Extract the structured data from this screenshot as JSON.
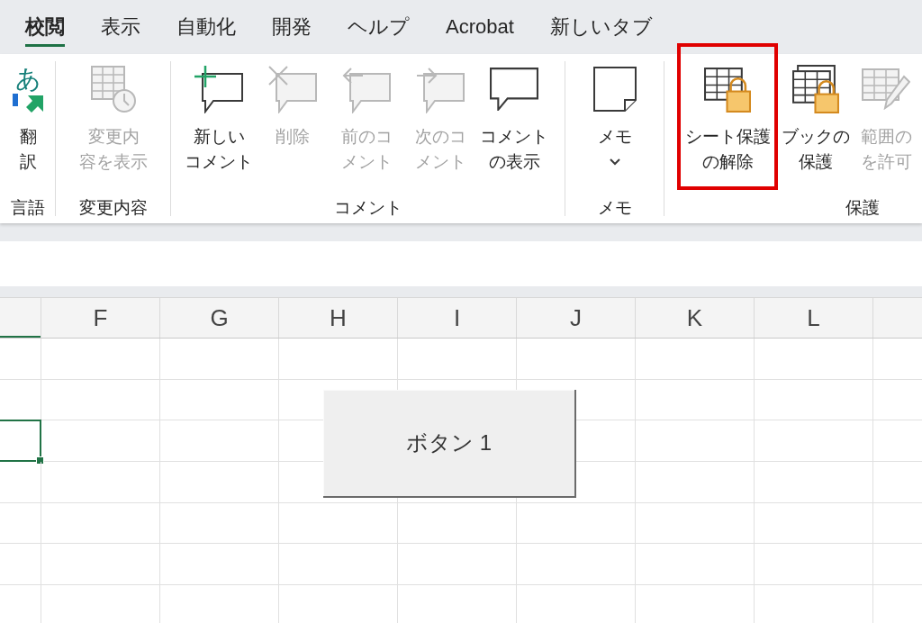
{
  "tabs": [
    {
      "label": "校閲",
      "selected": true
    },
    {
      "label": "表示",
      "selected": false
    },
    {
      "label": "自動化",
      "selected": false
    },
    {
      "label": "開発",
      "selected": false
    },
    {
      "label": "ヘルプ",
      "selected": false
    },
    {
      "label": "Acrobat",
      "selected": false
    },
    {
      "label": "新しいタブ",
      "selected": false
    }
  ],
  "ribbon": {
    "groups": [
      {
        "label": "言語",
        "buttons": [
          {
            "glyph": "あ",
            "lines": [
              "翻",
              "訳"
            ],
            "disabled": false,
            "dropdown": false,
            "highlighted": false
          }
        ]
      },
      {
        "label": "変更内容",
        "buttons": [
          {
            "lines": [
              "変更内",
              "容を表示"
            ],
            "disabled": true,
            "dropdown": false,
            "highlighted": false
          }
        ]
      },
      {
        "label": "コメント",
        "buttons": [
          {
            "lines": [
              "新しい",
              "コメント"
            ],
            "disabled": false,
            "dropdown": false,
            "highlighted": false
          },
          {
            "lines": [
              "削除"
            ],
            "disabled": true,
            "dropdown": false,
            "highlighted": false
          },
          {
            "lines": [
              "前のコ",
              "メント"
            ],
            "disabled": true,
            "dropdown": false,
            "highlighted": false
          },
          {
            "lines": [
              "次のコ",
              "メント"
            ],
            "disabled": true,
            "dropdown": false,
            "highlighted": false
          },
          {
            "lines": [
              "コメント",
              "の表示"
            ],
            "disabled": false,
            "dropdown": false,
            "highlighted": false
          }
        ]
      },
      {
        "label": "メモ",
        "buttons": [
          {
            "lines": [
              "メモ"
            ],
            "disabled": false,
            "dropdown": true,
            "highlighted": false
          }
        ]
      },
      {
        "label": "保護",
        "buttons": [
          {
            "lines": [
              "シート保護",
              "の解除"
            ],
            "disabled": false,
            "dropdown": false,
            "highlighted": true
          },
          {
            "lines": [
              "ブックの",
              "保護"
            ],
            "disabled": false,
            "dropdown": false,
            "highlighted": false
          },
          {
            "lines": [
              "範囲の",
              "を許可"
            ],
            "disabled": true,
            "dropdown": false,
            "highlighted": false
          }
        ]
      }
    ]
  },
  "sheet": {
    "leading_column": {
      "selected": true,
      "active_cell": true
    },
    "columns": [
      {
        "label": "F"
      },
      {
        "label": "G"
      },
      {
        "label": "H"
      },
      {
        "label": "I"
      },
      {
        "label": "J"
      },
      {
        "label": "K"
      },
      {
        "label": "L"
      }
    ],
    "form_button": {
      "label": "ボタン 1"
    }
  }
}
